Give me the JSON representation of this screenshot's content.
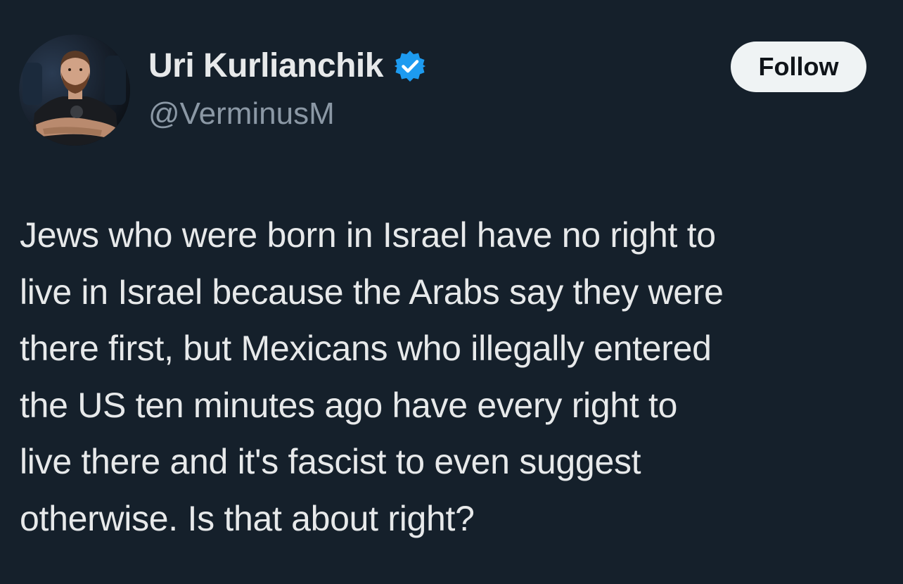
{
  "tweet": {
    "author": {
      "display_name": "Uri Kurlianchik",
      "handle": "@VerminusM",
      "verified": true,
      "verified_color": "#1d9bf0",
      "avatar_icon": "profile-photo"
    },
    "follow_label": "Follow",
    "text_lines": [
      "Jews who were born in Israel have no right to",
      "live in Israel because the Arabs say they were",
      "there first, but Mexicans who illegally entered",
      "the US ten minutes ago have every right to",
      "live there and it's fascist to even suggest",
      "otherwise. Is that about right?"
    ]
  },
  "colors": {
    "background": "#15202b",
    "primary_text": "#e7e9ea",
    "secondary_text": "#8b98a5",
    "button_bg": "#eff3f4",
    "button_text": "#0f1419"
  }
}
